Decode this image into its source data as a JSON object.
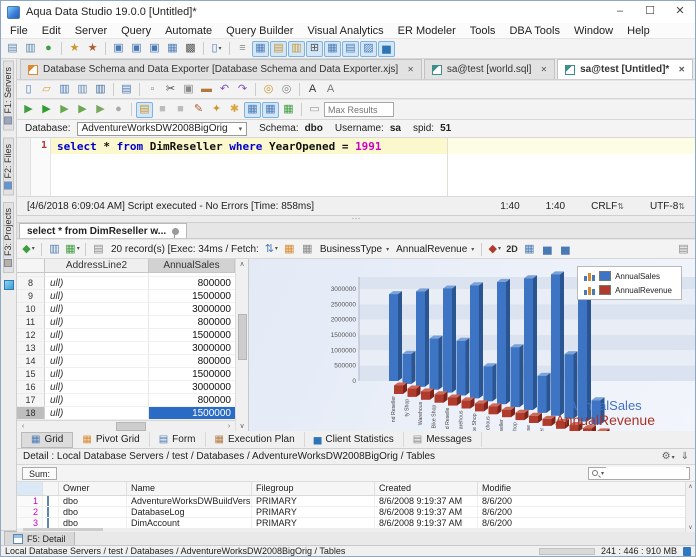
{
  "window": {
    "title": "Aqua Data Studio 19.0.0 [Untitled]*",
    "minimize": "–",
    "maximize": "☐",
    "close": "✕"
  },
  "menu_bar": {
    "items": [
      "File",
      "Edit",
      "Server",
      "Query",
      "Automate",
      "Query Builder",
      "Visual Analytics",
      "ER Modeler",
      "Tools",
      "DBA Tools",
      "Window",
      "Help"
    ]
  },
  "main_toolbar": {
    "items": [
      {
        "n": "register-server-icon",
        "g": "▤",
        "c": "#5b87b0"
      },
      {
        "n": "register-server-group-icon",
        "g": "▥",
        "c": "#5b87b0"
      },
      {
        "n": "connect-server-icon",
        "g": "●",
        "c": "#3f9e3f"
      },
      {
        "sep": true
      },
      {
        "n": "new-query-analyzer-icon",
        "g": "★",
        "c": "#c9972e"
      },
      {
        "n": "new-query-builder-icon",
        "g": "★",
        "c": "#b05a2e"
      },
      {
        "sep": true
      },
      {
        "n": "query-analyzer-icon",
        "g": "▣",
        "c": "#4a7ab5"
      },
      {
        "n": "schema-browser-icon",
        "g": "▣",
        "c": "#4a7ab5"
      },
      {
        "n": "table-data-editor-icon",
        "g": "▣",
        "c": "#4a7ab5"
      },
      {
        "n": "er-diagram-icon",
        "g": "▦",
        "c": "#4a7ab5"
      },
      {
        "n": "dark-grid-icon",
        "g": "▩",
        "c": "#555555"
      },
      {
        "sep": true
      },
      {
        "n": "new-document-icon",
        "g": "▯",
        "c": "#4a7ab5",
        "dd": true
      },
      {
        "sep": true
      },
      {
        "n": "script-icon",
        "g": "≡",
        "c": "#8a8a8a"
      },
      {
        "n": "toggle-grid-window-icon",
        "g": "▦",
        "c": "#4a7ab5",
        "a": true
      },
      {
        "n": "toggle-files-window-icon",
        "g": "▤",
        "c": "#c9972e",
        "a": true
      },
      {
        "n": "toggle-highlight-window-icon",
        "g": "▥",
        "c": "#c9972e",
        "a": true
      },
      {
        "n": "toggle-table-window-icon",
        "g": "⊞",
        "c": "#555555",
        "a": true
      },
      {
        "n": "toggle-pivot-window-icon",
        "g": "▦",
        "c": "#4a7ab5",
        "a": true
      },
      {
        "n": "toggle-form-window-icon",
        "g": "▤",
        "c": "#4a7ab5",
        "a": true
      },
      {
        "n": "toggle-plan-window-icon",
        "g": "▨",
        "c": "#4a7ab5",
        "a": true
      },
      {
        "n": "toggle-chart-window-icon",
        "g": "▅",
        "c": "#2e75b6",
        "a": true
      }
    ]
  },
  "document_tabs": {
    "close_glyph": "✕",
    "tabs": [
      {
        "label": "Database Schema and Data Exporter [Database Schema and Data Exporter.xjs]",
        "active": false,
        "icon": "script-file-icon",
        "icon_color": "#d9892e"
      },
      {
        "label": "sa@test [world.sql]",
        "active": false,
        "icon": "sql-file-icon",
        "icon_color": "#3f8e8e"
      },
      {
        "label": "sa@test [Untitled]*",
        "active": true,
        "icon": "sql-file-icon",
        "icon_color": "#3f8e8e"
      }
    ]
  },
  "left_dock": {
    "tabs": [
      {
        "label": "F1: Servers",
        "icon": "servers-icon",
        "icon_color": "#9aa8b8"
      },
      {
        "label": "F2: Files",
        "icon": "files-icon",
        "icon_color": "#5b9bd5"
      },
      {
        "label": "F3: Projects",
        "icon": "projects-icon",
        "icon_color": "#b8b0a0"
      }
    ],
    "cube_icon": "project-cube-icon"
  },
  "editor": {
    "toolbar_row1": [
      {
        "n": "new-file-icon",
        "g": "▯",
        "c": "#4a7ab5"
      },
      {
        "n": "open-file-icon",
        "g": "▱",
        "c": "#d9a43f"
      },
      {
        "n": "save-icon",
        "g": "▥",
        "c": "#4a7ab5"
      },
      {
        "n": "save-as-icon",
        "g": "▥",
        "c": "#6a8fb5"
      },
      {
        "n": "save-all-icon",
        "g": "▥",
        "c": "#3f6fa5"
      },
      {
        "sep": true
      },
      {
        "n": "print-icon",
        "g": "▤",
        "c": "#4a7ab5"
      },
      {
        "sep": true
      },
      {
        "n": "select-mode-icon",
        "g": "▫",
        "c": "#888888"
      },
      {
        "n": "cut-icon",
        "g": "✂",
        "c": "#444444"
      },
      {
        "n": "copy-icon",
        "g": "▣",
        "c": "#888888"
      },
      {
        "n": "paste-icon",
        "g": "▬",
        "c": "#b07a3f"
      },
      {
        "n": "undo-icon",
        "g": "↶",
        "c": "#7a4fb5"
      },
      {
        "n": "redo-icon",
        "g": "↷",
        "c": "#7a4fb5"
      },
      {
        "sep": true
      },
      {
        "n": "find-icon",
        "g": "◎",
        "c": "#c9972e"
      },
      {
        "n": "find-next-icon",
        "g": "◎",
        "c": "#888888"
      },
      {
        "sep": true
      },
      {
        "n": "font-increase-icon",
        "g": "A",
        "c": "#333333"
      },
      {
        "n": "font-decrease-icon",
        "g": "A",
        "c": "#777777"
      }
    ],
    "toolbar_row2": [
      {
        "n": "execute-options-icon",
        "g": "▶",
        "c": "#3f9e3f"
      },
      {
        "n": "execute-icon",
        "g": "▶",
        "c": "#2f9e2f"
      },
      {
        "n": "execute-edit-icon",
        "g": "▶",
        "c": "#6aa84f"
      },
      {
        "n": "execute-explain-icon",
        "g": "▶",
        "c": "#6aa84f"
      },
      {
        "n": "execute-batch-icon",
        "g": "▶",
        "c": "#78a860"
      },
      {
        "n": "stop-icon",
        "g": "●",
        "c": "#aaaaaa"
      },
      {
        "sep": true
      },
      {
        "n": "pin-results-icon",
        "g": "▤",
        "c": "#c9972e",
        "a": true
      },
      {
        "n": "pause-icon",
        "g": "■",
        "c": "#bbbbbb"
      },
      {
        "n": "cancel-icon",
        "g": "■",
        "c": "#bbbbbb"
      },
      {
        "n": "format-sql-icon",
        "g": "✎",
        "c": "#b05a2e"
      },
      {
        "n": "describe-icon",
        "g": "✦",
        "c": "#c9972e"
      },
      {
        "n": "completion-icon",
        "g": "✱",
        "c": "#d9a43f"
      },
      {
        "n": "split-window-icon",
        "g": "▦",
        "c": "#4a7ab5",
        "a": true
      },
      {
        "n": "split-window-2-icon",
        "g": "▦",
        "c": "#4a7ab5",
        "a": true
      },
      {
        "n": "grid-results-icon",
        "g": "▦",
        "c": "#3f9e3f"
      },
      {
        "sep": true
      },
      {
        "n": "history-icon",
        "g": "▭",
        "c": "#999999"
      },
      {
        "input": true,
        "n": "max-results-input",
        "placeholder": "Max Results"
      }
    ],
    "max_results_placeholder": "Max Results",
    "context": {
      "database_label": "Database:",
      "database_value": "AdventureWorksDW2008BigOrig",
      "schema_label": "Schema:",
      "schema_value": "dbo",
      "username_label": "Username:",
      "username_value": "sa",
      "spid_label": "spid:",
      "spid_value": "51"
    },
    "code": {
      "line_number": "1",
      "tokens": [
        {
          "t": "select",
          "c": "keyword"
        },
        {
          "t": " * ",
          "c": "plain"
        },
        {
          "t": "from",
          "c": "keyword"
        },
        {
          "t": " DimReseller ",
          "c": "plain"
        },
        {
          "t": "where",
          "c": "keyword"
        },
        {
          "t": " YearOpened = ",
          "c": "plain"
        },
        {
          "t": "1991",
          "c": "number"
        }
      ]
    },
    "status": {
      "message": "[4/6/2018 6:09:04 AM] Script executed - No Errors [Time: 858ms]",
      "pos1": "1:40",
      "pos2": "1:40",
      "eol": "CRLF",
      "encoding": "UTF-8"
    }
  },
  "results": {
    "tab_label": "select * from DimReseller w...",
    "toolbar": [
      {
        "n": "chart-wizard-icon",
        "g": "◆",
        "c": "#3f9e3f",
        "dd": true
      },
      {
        "sep": true
      },
      {
        "n": "export-results-icon",
        "g": "▥",
        "c": "#4a7ab5"
      },
      {
        "n": "export-excel-icon",
        "g": "▦",
        "c": "#3f9e3f",
        "dd": true
      },
      {
        "sep": true
      },
      {
        "n": "print-results-icon",
        "g": "▤",
        "c": "#888888"
      },
      {
        "text": "20 record(s) [Exec: 34ms / Fetch:",
        "n": "record-count-text"
      },
      {
        "n": "sort-icon",
        "g": "⇅",
        "c": "#4a7ab5",
        "dd": true
      },
      {
        "n": "pivot-icon",
        "g": "▦",
        "c": "#d9892e"
      },
      {
        "n": "date-format-icon",
        "g": "▦",
        "c": "#888888"
      },
      {
        "combo": "BusinessType",
        "n": "business-type-combo"
      },
      {
        "combo": "AnnualRevenue",
        "n": "annual-revenue-combo"
      },
      {
        "sep": true
      },
      {
        "n": "palette-icon",
        "g": "◆",
        "c": "#b03a2e",
        "dd": true
      },
      {
        "label": "2D",
        "n": "mode-2d-toggle"
      },
      {
        "n": "chart-edit-icon",
        "g": "▦",
        "c": "#4a7ab5"
      },
      {
        "n": "chart-copy-icon",
        "g": "▅",
        "c": "#4a7ab5"
      },
      {
        "n": "chart-save-icon",
        "g": "▅",
        "c": "#4a7ab5"
      },
      {
        "flex": true
      },
      {
        "n": "layout-icon",
        "g": "▤",
        "c": "#888888"
      }
    ],
    "grid": {
      "columns": [
        "AddressLine2",
        "AnnualSales"
      ],
      "rows": [
        {
          "n": "8",
          "address": "ull)",
          "sales": "800000"
        },
        {
          "n": "9",
          "address": "ull)",
          "sales": "1500000"
        },
        {
          "n": "10",
          "address": "ull)",
          "sales": "3000000"
        },
        {
          "n": "11",
          "address": "ull)",
          "sales": "800000"
        },
        {
          "n": "12",
          "address": "ull)",
          "sales": "1500000"
        },
        {
          "n": "13",
          "address": "ull)",
          "sales": "3000000"
        },
        {
          "n": "14",
          "address": "ull)",
          "sales": "800000"
        },
        {
          "n": "15",
          "address": "ull)",
          "sales": "1500000"
        },
        {
          "n": "16",
          "address": "ull)",
          "sales": "3000000"
        },
        {
          "n": "17",
          "address": "ull)",
          "sales": "800000"
        },
        {
          "n": "18",
          "address": "ull)",
          "sales": "1500000",
          "selected": true
        }
      ]
    },
    "bottom_tabs": [
      {
        "label": "Grid",
        "active": true,
        "g": "▦",
        "c": "#4a7ab5"
      },
      {
        "label": "Pivot Grid",
        "active": false,
        "g": "▦",
        "c": "#d9892e"
      },
      {
        "label": "Form",
        "active": false,
        "g": "▤",
        "c": "#4a7ab5"
      },
      {
        "label": "Execution Plan",
        "active": false,
        "g": "▦",
        "c": "#b07a3f"
      },
      {
        "label": "Client Statistics",
        "active": false,
        "g": "▅",
        "c": "#2e75b6"
      },
      {
        "label": "Messages",
        "active": false,
        "g": "▤",
        "c": "#888888"
      }
    ]
  },
  "chart_data": {
    "type": "bar",
    "projection": "3d",
    "title": "",
    "xlabel": "",
    "ylabel": "",
    "ylim": [
      0,
      3000000
    ],
    "yticks": [
      0,
      500000,
      1000000,
      1500000,
      2000000,
      2500000,
      3000000
    ],
    "grid": "horizontal-bands",
    "legend_position": "top-right",
    "categories": [
      "nd Reseller",
      "ty Shop",
      "Warehous",
      "Bike Shop",
      "d Reselle",
      "arehous",
      "ke Shop",
      "chous",
      "eseller",
      "Shop",
      "ouse",
      "eller",
      "hop",
      "ise",
      "ler",
      "e"
    ],
    "series": [
      {
        "name": "AnnualSales",
        "color": "#3d74c4",
        "values": [
          2850000,
          950000,
          2900000,
          1500000,
          2950000,
          1500000,
          3000000,
          900000,
          3050000,
          1450000,
          3100000,
          850000,
          3150000,
          1400000,
          3200000,
          500000
        ]
      },
      {
        "name": "AnnualRevenue",
        "color": "#b03a2c",
        "values": [
          330000,
          310000,
          300000,
          290000,
          270000,
          260000,
          250000,
          240000,
          220000,
          210000,
          200000,
          190000,
          180000,
          170000,
          160000,
          150000
        ]
      }
    ],
    "overlay_labels": [
      {
        "text": "AnnualSales",
        "color": "#4472c4"
      },
      {
        "text": "AnnualRevenue",
        "color": "#a93226"
      }
    ]
  },
  "detail": {
    "title": "Detail : Local Database Servers / test / Databases / AdventureWorksDW2008BigOrig / Tables",
    "sum_label": "Sum:",
    "dock_tab": "F5: Detail",
    "table": {
      "columns": [
        "",
        "",
        "Owner",
        "Name",
        "Filegroup",
        "Created",
        "Modifie"
      ],
      "rows": [
        {
          "num": "1",
          "owner": "dbo",
          "name": "AdventureWorksDWBuildVersion",
          "filegroup": "PRIMARY",
          "created": "8/6/2008 9:19:37 AM",
          "modified": "8/6/200"
        },
        {
          "num": "2",
          "owner": "dbo",
          "name": "DatabaseLog",
          "filegroup": "PRIMARY",
          "created": "8/6/2008 9:19:37 AM",
          "modified": "8/6/200"
        },
        {
          "num": "3",
          "owner": "dbo",
          "name": "DimAccount",
          "filegroup": "PRIMARY",
          "created": "8/6/2008 9:19:37 AM",
          "modified": "8/6/200"
        }
      ]
    }
  },
  "status_bar": {
    "left": "Local Database Servers / test / Databases / AdventureWorksDW2008BigOrig / Tables",
    "right": "241 : 446 : 910 MB"
  }
}
